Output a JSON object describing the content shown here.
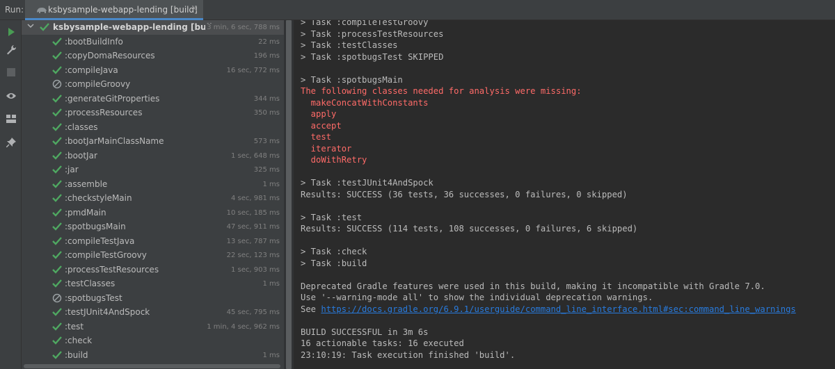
{
  "run_label": "Run:",
  "tab": {
    "title": "ksbysample-webapp-lending [build]",
    "close": "×"
  },
  "toolbar": {
    "buttons": [
      "rerun-icon",
      "wrench-icon",
      "stop-icon",
      "eye-icon",
      "layout-icon",
      "pin-icon"
    ]
  },
  "tree": {
    "root": {
      "label": "ksbysample-webapp-lending [build]:",
      "status": "succ",
      "time": "3 min, 6 sec, 788 ms"
    },
    "tasks": [
      {
        "label": ":bootBuildInfo",
        "time": "22 ms",
        "status": "success"
      },
      {
        "label": ":copyDomaResources",
        "time": "196 ms",
        "status": "success"
      },
      {
        "label": ":compileJava",
        "time": "16 sec, 772 ms",
        "status": "success"
      },
      {
        "label": ":compileGroovy",
        "time": "",
        "status": "skipped"
      },
      {
        "label": ":generateGitProperties",
        "time": "344 ms",
        "status": "success"
      },
      {
        "label": ":processResources",
        "time": "350 ms",
        "status": "success"
      },
      {
        "label": ":classes",
        "time": "",
        "status": "success"
      },
      {
        "label": ":bootJarMainClassName",
        "time": "573 ms",
        "status": "success"
      },
      {
        "label": ":bootJar",
        "time": "1 sec, 648 ms",
        "status": "success"
      },
      {
        "label": ":jar",
        "time": "325 ms",
        "status": "success"
      },
      {
        "label": ":assemble",
        "time": "1 ms",
        "status": "success"
      },
      {
        "label": ":checkstyleMain",
        "time": "4 sec, 981 ms",
        "status": "success"
      },
      {
        "label": ":pmdMain",
        "time": "10 sec, 185 ms",
        "status": "success"
      },
      {
        "label": ":spotbugsMain",
        "time": "47 sec, 911 ms",
        "status": "success"
      },
      {
        "label": ":compileTestJava",
        "time": "13 sec, 787 ms",
        "status": "success"
      },
      {
        "label": ":compileTestGroovy",
        "time": "22 sec, 123 ms",
        "status": "success"
      },
      {
        "label": ":processTestResources",
        "time": "1 sec, 903 ms",
        "status": "success"
      },
      {
        "label": ":testClasses",
        "time": "1 ms",
        "status": "success"
      },
      {
        "label": ":spotbugsTest",
        "time": "",
        "status": "skipped"
      },
      {
        "label": ":testJUnit4AndSpock",
        "time": "45 sec, 795 ms",
        "status": "success"
      },
      {
        "label": ":test",
        "time": "1 min, 4 sec, 962 ms",
        "status": "success"
      },
      {
        "label": ":check",
        "time": "",
        "status": "success"
      },
      {
        "label": ":build",
        "time": "1 ms",
        "status": "success"
      }
    ]
  },
  "console": {
    "lines": [
      {
        "text": "> Task :compileTestGroovy",
        "color": "normal"
      },
      {
        "text": "> Task :processTestResources",
        "color": "normal"
      },
      {
        "text": "> Task :testClasses",
        "color": "normal"
      },
      {
        "text": "> Task :spotbugsTest SKIPPED",
        "color": "normal"
      },
      {
        "text": "",
        "color": "normal"
      },
      {
        "text": "> Task :spotbugsMain",
        "color": "normal"
      },
      {
        "text": "The following classes needed for analysis were missing:",
        "color": "red"
      },
      {
        "text": "  makeConcatWithConstants",
        "color": "red"
      },
      {
        "text": "  apply",
        "color": "red"
      },
      {
        "text": "  accept",
        "color": "red"
      },
      {
        "text": "  test",
        "color": "red"
      },
      {
        "text": "  iterator",
        "color": "red"
      },
      {
        "text": "  doWithRetry",
        "color": "red"
      },
      {
        "text": "",
        "color": "normal"
      },
      {
        "text": "> Task :testJUnit4AndSpock",
        "color": "normal"
      },
      {
        "text": "Results: SUCCESS (36 tests, 36 successes, 0 failures, 0 skipped)",
        "color": "normal"
      },
      {
        "text": "",
        "color": "normal"
      },
      {
        "text": "> Task :test",
        "color": "normal"
      },
      {
        "text": "Results: SUCCESS (114 tests, 108 successes, 0 failures, 6 skipped)",
        "color": "normal"
      },
      {
        "text": "",
        "color": "normal"
      },
      {
        "text": "> Task :check",
        "color": "normal"
      },
      {
        "text": "> Task :build",
        "color": "normal"
      },
      {
        "text": "",
        "color": "normal"
      },
      {
        "text": "Deprecated Gradle features were used in this build, making it incompatible with Gradle 7.0.",
        "color": "normal"
      },
      {
        "text": "Use '--warning-mode all' to show the individual deprecation warnings.",
        "color": "normal"
      },
      {
        "text": "See ",
        "color": "normal",
        "link": "https://docs.gradle.org/6.9.1/userguide/command_line_interface.html#sec:command_line_warnings"
      },
      {
        "text": "",
        "color": "normal"
      },
      {
        "text": "BUILD SUCCESSFUL in 3m 6s",
        "color": "normal"
      },
      {
        "text": "16 actionable tasks: 16 executed",
        "color": "normal"
      },
      {
        "text": "23:10:19: Task execution finished 'build'.",
        "color": "normal"
      }
    ]
  },
  "colors": {
    "success": "#4fa861",
    "skipped": "#9aa0a3",
    "error_text": "#ff6b68",
    "link": "#287bde",
    "accent": "#4a88c7"
  }
}
